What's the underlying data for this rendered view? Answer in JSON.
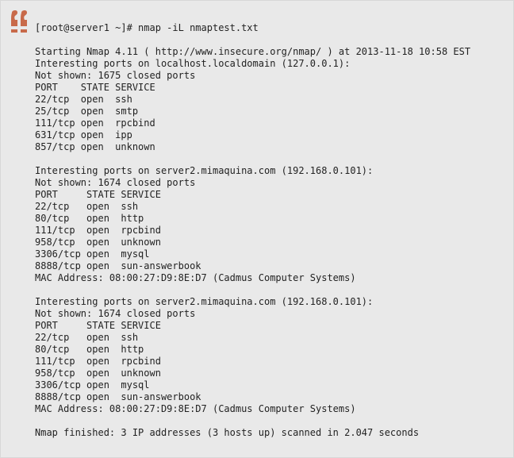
{
  "quote_icon": {
    "name": "quote-icon",
    "color": "#c86a4a"
  },
  "terminal": {
    "command_line": "[root@server1 ~]# nmap -iL nmaptest.txt",
    "start_line": "Starting Nmap 4.11 ( http://www.insecure.org/nmap/ ) at 2013-11-18 10:58 EST",
    "hosts": [
      {
        "interesting": "Interesting ports on localhost.localdomain (127.0.0.1):",
        "not_shown": "Not shown: 1675 closed ports",
        "header": "PORT    STATE SERVICE",
        "ports": [
          "22/tcp  open  ssh",
          "25/tcp  open  smtp",
          "111/tcp open  rpcbind",
          "631/tcp open  ipp",
          "857/tcp open  unknown"
        ]
      },
      {
        "interesting": "Interesting ports on server2.mimaquina.com (192.168.0.101):",
        "not_shown": "Not shown: 1674 closed ports",
        "header": "PORT     STATE SERVICE",
        "ports": [
          "22/tcp   open  ssh",
          "80/tcp   open  http",
          "111/tcp  open  rpcbind",
          "958/tcp  open  unknown",
          "3306/tcp open  mysql",
          "8888/tcp open  sun-answerbook"
        ],
        "mac": "MAC Address: 08:00:27:D9:8E:D7 (Cadmus Computer Systems)"
      },
      {
        "interesting": "Interesting ports on server2.mimaquina.com (192.168.0.101):",
        "not_shown": "Not shown: 1674 closed ports",
        "header": "PORT     STATE SERVICE",
        "ports": [
          "22/tcp   open  ssh",
          "80/tcp   open  http",
          "111/tcp  open  rpcbind",
          "958/tcp  open  unknown",
          "3306/tcp open  mysql",
          "8888/tcp open  sun-answerbook"
        ],
        "mac": "MAC Address: 08:00:27:D9:8E:D7 (Cadmus Computer Systems)"
      }
    ],
    "finish_line": "Nmap finished: 3 IP addresses (3 hosts up) scanned in 2.047 seconds"
  }
}
